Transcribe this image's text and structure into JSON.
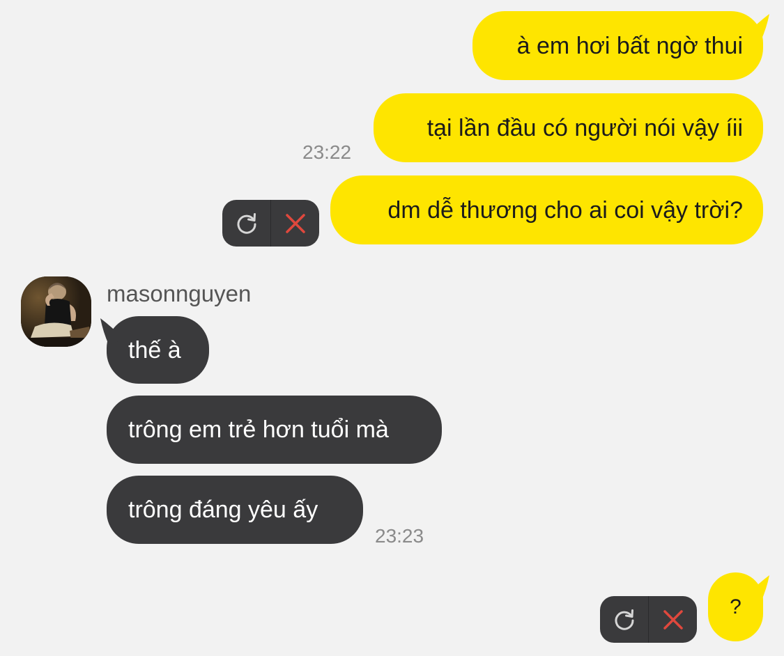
{
  "messages_out": [
    {
      "text": "à em hơi bất ngờ thui"
    },
    {
      "text": "tại lần đầu có người nói vậy íii",
      "time": "23:22"
    },
    {
      "text": "dm dễ thương cho ai coi vậy trời?",
      "status": "failed"
    }
  ],
  "incoming": {
    "sender": "masonnguyen",
    "avatar": "profile-photo",
    "messages": [
      {
        "text": "thế à"
      },
      {
        "text": "trông em trẻ hơn tuổi mà"
      },
      {
        "text": "trông đáng yêu ấy",
        "time": "23:23"
      }
    ]
  },
  "last_out": {
    "text": "?",
    "status": "failed"
  },
  "icons": {
    "retry": "refresh-icon",
    "delete": "close-icon"
  },
  "colors": {
    "background": "#f2f2f2",
    "outgoing_bubble": "#fee500",
    "incoming_bubble": "#3a3a3c",
    "delete_icon": "#e0483d"
  }
}
